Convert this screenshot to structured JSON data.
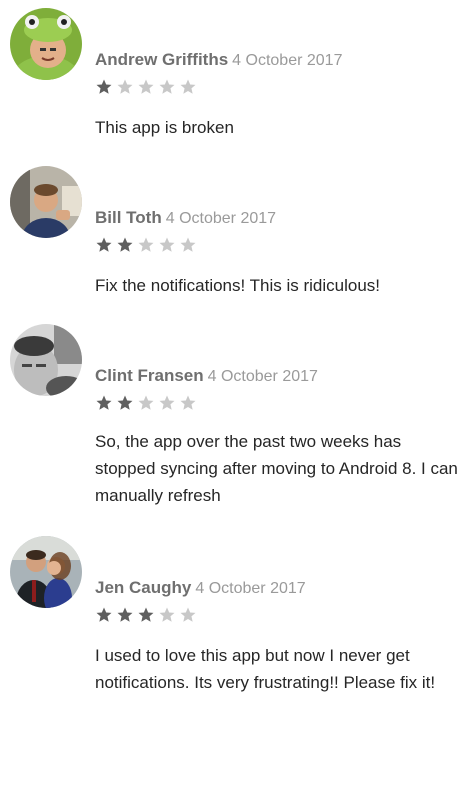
{
  "reviews": [
    {
      "author": "Andrew Griffiths",
      "date": "4 October 2017",
      "rating": 1,
      "max_rating": 5,
      "text": "This app is broken"
    },
    {
      "author": "Bill Toth",
      "date": "4 October 2017",
      "rating": 2,
      "max_rating": 5,
      "text": "Fix the notifications! This is ridiculous!"
    },
    {
      "author": "Clint Fransen",
      "date": "4 October 2017",
      "rating": 2,
      "max_rating": 5,
      "text": "So, the app over the past two weeks has stopped syncing after moving to Android 8. I can manually refresh"
    },
    {
      "author": "Jen Caughy",
      "date": "4 October 2017",
      "rating": 3,
      "max_rating": 5,
      "text": "I used to love this app but now I never get notifications. Its very frustrating!! Please fix it!"
    }
  ],
  "colors": {
    "star_filled": "#5f5f5f",
    "star_empty": "#c8c8c8"
  }
}
